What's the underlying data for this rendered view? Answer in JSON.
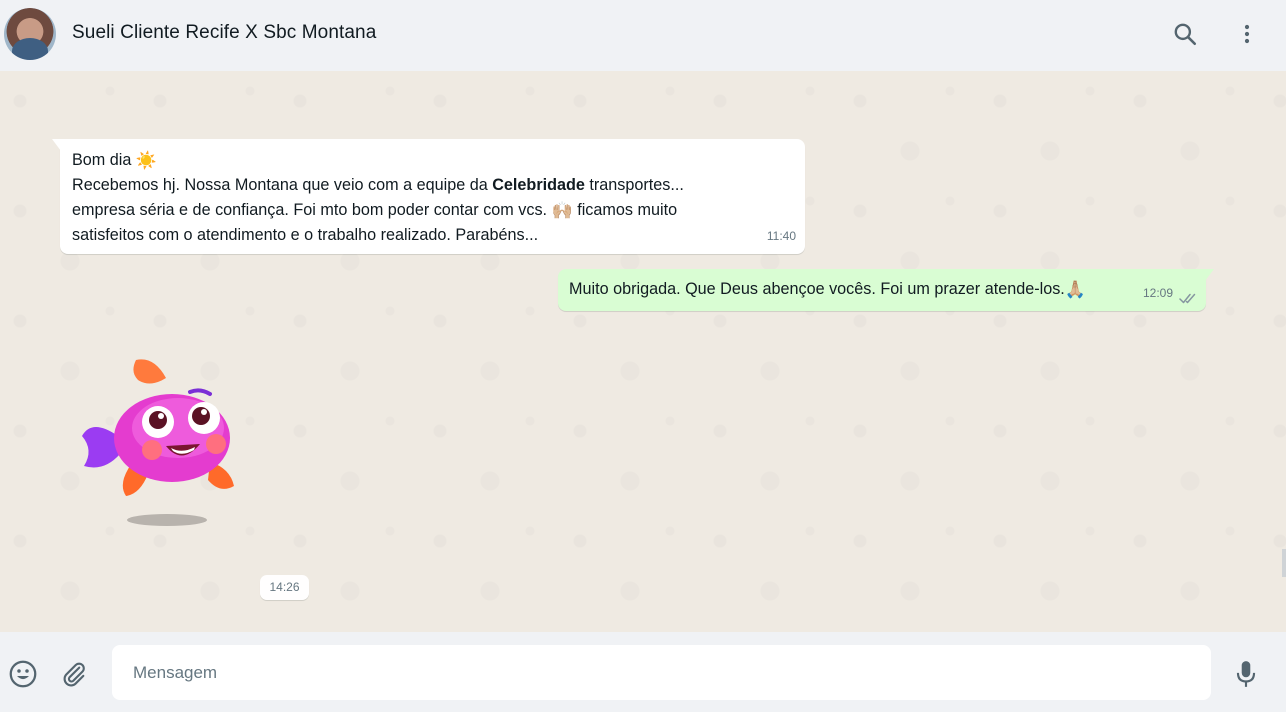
{
  "header": {
    "chat_title": "Sueli Cliente Recife X Sbc Montana",
    "icons": [
      "avatar",
      "search-icon",
      "menu-icon"
    ]
  },
  "messages": [
    {
      "direction": "incoming",
      "greeting": "Bom dia",
      "greeting_emoji": "☀️",
      "line1_before": "Recebemos hj. Nossa Montana que veio com a equipe da ",
      "line1_bold": "Celebridade",
      "line1_after": " transportes...",
      "line2_before": "empresa séria e de confiança. Foi mto bom poder contar com vcs. ",
      "line2_emoji": "🙌🏼",
      "line2_after": " ficamos muito",
      "line3": "satisfeitos com o atendimento e o trabalho realizado. Parabéns...",
      "time": "11:40"
    },
    {
      "direction": "outgoing",
      "text": "Muito obrigada. Que Deus abençoe vocês. Foi um prazer atende-los.",
      "emoji": "🙏🏼",
      "time": "12:09",
      "status": "read"
    },
    {
      "direction": "incoming",
      "type": "sticker",
      "sticker": "purple-fish-sticker",
      "time": "14:26"
    }
  ],
  "composer": {
    "placeholder": "Mensagem",
    "value": "",
    "icons": [
      "emoji-icon",
      "attach-icon",
      "mic-icon"
    ]
  },
  "colors": {
    "header_bg": "#f0f2f5",
    "chat_bg": "#efeae2",
    "incoming_bubble": "#ffffff",
    "outgoing_bubble": "#d9fdd3",
    "time_text": "#667781",
    "read_ticks": "#8696a0"
  }
}
